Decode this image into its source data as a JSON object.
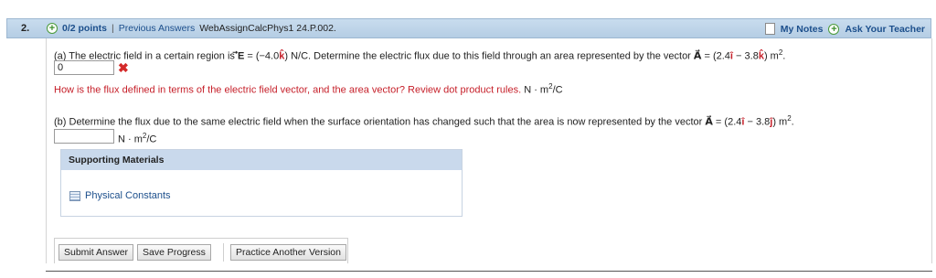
{
  "header": {
    "question_number": "2.",
    "points": "0/2 points",
    "separator": "|",
    "previous_answers": "Previous Answers",
    "assignment_id": "WebAssignCalcPhys1 24.P.002.",
    "my_notes": "My Notes",
    "ask_teacher": "Ask Your Teacher"
  },
  "part_a": {
    "text_1": "(a) The electric field in a certain region is ",
    "vec_E": "E",
    "text_2": " = (−4.0",
    "k_hat": "k",
    "text_3": ") N/C. Determine the electric flux due to this field through an area represented by the vector ",
    "vec_A": "A",
    "text_4": " = (2.4",
    "i_hat": "i",
    "text_5": " − 3.8",
    "k_hat_2": "k",
    "text_6": ") m",
    "exp": "2",
    "text_7": ".",
    "answer_value": "0",
    "hint": "How is the flux defined in terms of the electric field vector, and the area vector? Review dot product rules.",
    "unit_prefix": " N · m",
    "unit_exp": "2",
    "unit_suffix": "/C"
  },
  "part_b": {
    "text_1": "(b) Determine the flux due to the same electric field when the surface orientation has changed such that the area is now represented by the vector ",
    "vec_A": "A",
    "text_2": " = (2.4",
    "i_hat": "i",
    "text_3": " − 3.8",
    "j_hat": "j",
    "text_4": ") m",
    "exp": "2",
    "text_5": ".",
    "answer_value": "",
    "unit_prefix": "N · m",
    "unit_exp": "2",
    "unit_suffix": "/C"
  },
  "support": {
    "heading": "Supporting Materials",
    "link": "Physical Constants"
  },
  "buttons": {
    "submit": "Submit Answer",
    "save": "Save Progress",
    "practice": "Practice Another Version"
  },
  "colors": {
    "header_bg": "#c8dcee",
    "link": "#1c4f8c",
    "error": "#c6202a"
  }
}
